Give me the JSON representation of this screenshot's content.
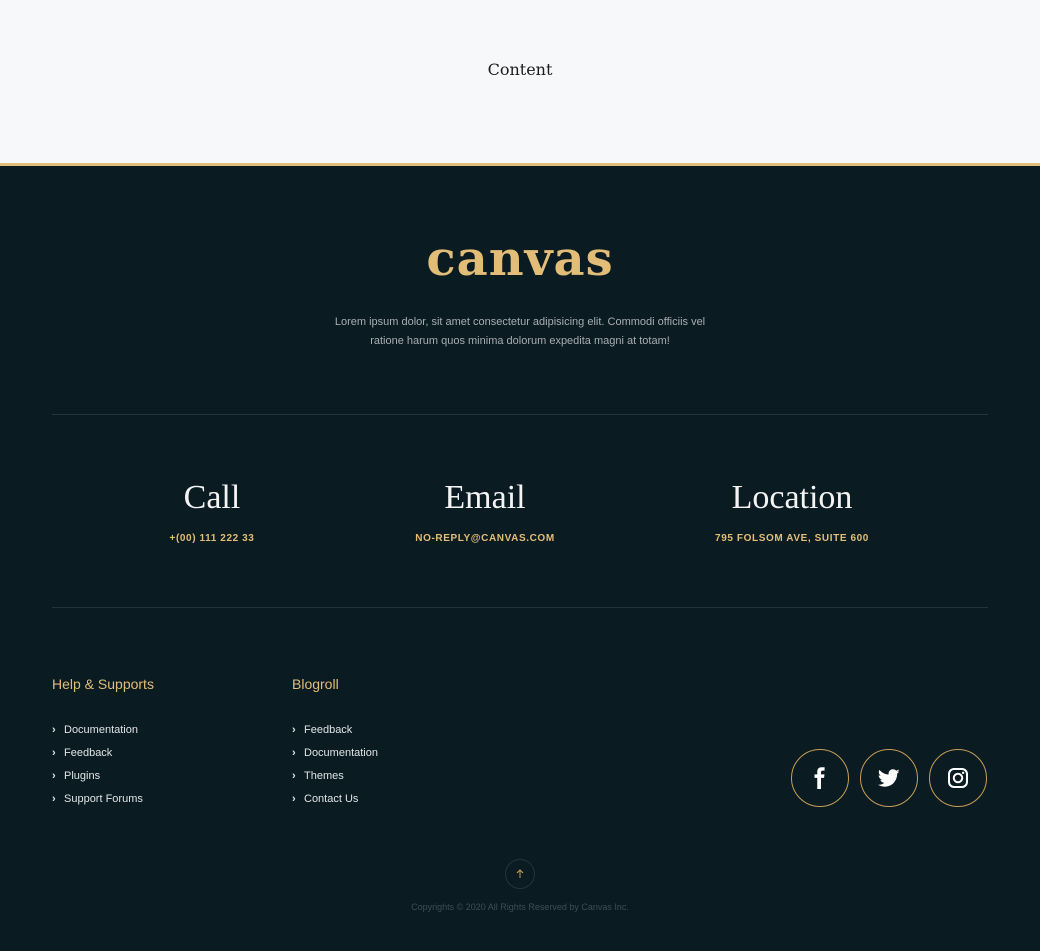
{
  "content": {
    "label": "Content"
  },
  "footer": {
    "logo": "canvas",
    "description": "Lorem ipsum dolor, sit amet consectetur adipisicing elit. Commodi officiis vel ratione harum quos minima dolorum expedita magni at totam!",
    "contacts": [
      {
        "title": "Call",
        "value": "+(00) 111 222 33"
      },
      {
        "title": "Email",
        "value": "NO-REPLY@CANVAS.COM"
      },
      {
        "title": "Location",
        "value": "795 FOLSOM AVE, SUITE 600"
      }
    ],
    "help": {
      "heading": "Help & Supports",
      "links": [
        "Documentation",
        "Feedback",
        "Plugins",
        "Support Forums"
      ]
    },
    "blogroll": {
      "heading": "Blogroll",
      "links": [
        "Feedback",
        "Documentation",
        "Themes",
        "Contact Us"
      ]
    },
    "social": [
      {
        "name": "facebook-icon"
      },
      {
        "name": "twitter-icon"
      },
      {
        "name": "instagram-icon"
      }
    ],
    "back_to_top_icon": "arrow-up-icon",
    "copyright": "Copyrights © 2020 All Rights Reserved by Canvas Inc.",
    "colors": {
      "accent": "#e2bd77",
      "background": "#0b1b22",
      "content_bg": "#f7f8fa"
    }
  }
}
